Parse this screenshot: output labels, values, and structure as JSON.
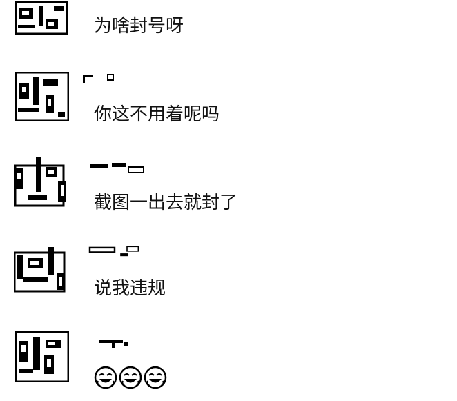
{
  "chat": {
    "messages": [
      {
        "text": "为啥封号呀"
      },
      {
        "text": "你这不用着呢吗"
      },
      {
        "text": "截图一出去就封了"
      },
      {
        "text": "说我违规"
      },
      {
        "emojis": [
          "laughing-emoji",
          "laughing-emoji",
          "laughing-emoji"
        ]
      }
    ]
  }
}
